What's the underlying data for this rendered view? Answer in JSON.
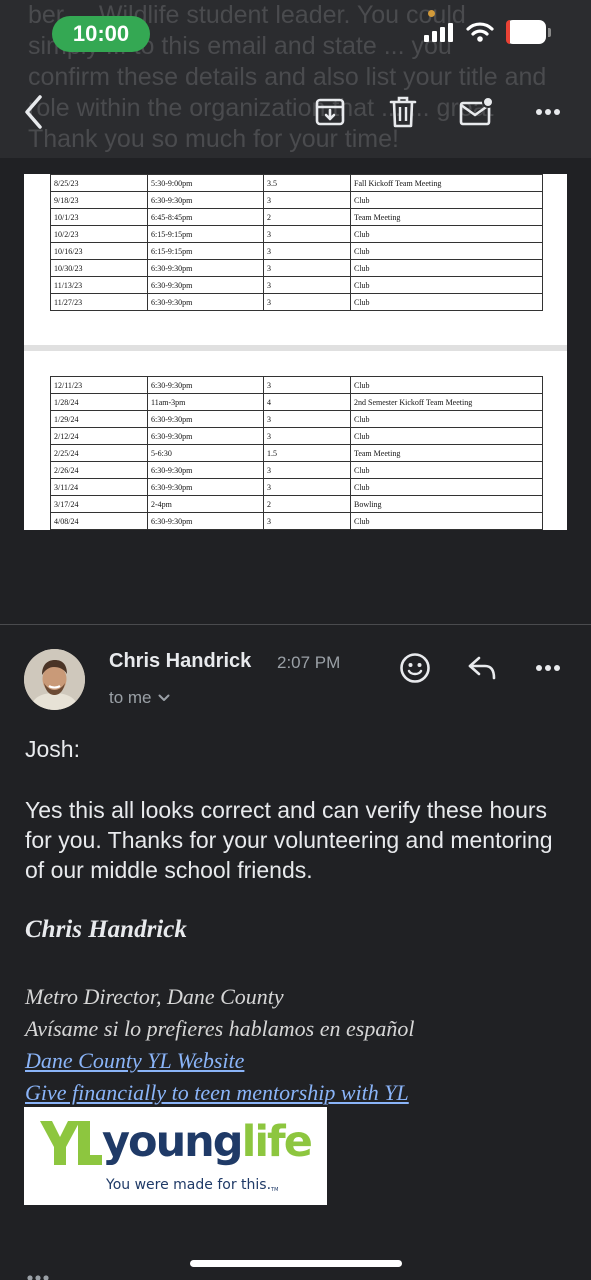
{
  "status_bar": {
    "time": "10:00",
    "battery": "10",
    "battery_level": 0.1
  },
  "background_message": {
    "text": "ber ... Wildlife student leader. You could\nsimply ... to this email and state ... you\nconfirm these details and also list your title and\nrole within the organization that ... ... great\nThank you so much for your time!"
  },
  "toolbar": {
    "back": "back",
    "archive": "archive",
    "delete": "delete",
    "mark_unread": "mark-unread",
    "more": "more"
  },
  "attachment_table": {
    "page1_rows": [
      [
        "8/25/23",
        "5:30-9:00pm",
        "3.5",
        "Fall Kickoff Team Meeting"
      ],
      [
        "9/18/23",
        "6:30-9:30pm",
        "3",
        "Club"
      ],
      [
        "10/1/23",
        "6:45-8:45pm",
        "2",
        "Team Meeting"
      ],
      [
        "10/2/23",
        "6:15-9:15pm",
        "3",
        "Club"
      ],
      [
        "10/16/23",
        "6:15-9:15pm",
        "3",
        "Club"
      ],
      [
        "10/30/23",
        "6:30-9:30pm",
        "3",
        "Club"
      ],
      [
        "11/13/23",
        "6:30-9:30pm",
        "3",
        "Club"
      ],
      [
        "11/27/23",
        "6:30-9:30pm",
        "3",
        "Club"
      ]
    ],
    "page2_rows": [
      [
        "12/11/23",
        "6:30-9:30pm",
        "3",
        "Club"
      ],
      [
        "1/28/24",
        "11am-3pm",
        "4",
        "2nd Semester Kickoff Team Meeting"
      ],
      [
        "1/29/24",
        "6:30-9:30pm",
        "3",
        "Club"
      ],
      [
        "2/12/24",
        "6:30-9:30pm",
        "3",
        "Club"
      ],
      [
        "2/25/24",
        "5-6:30",
        "1.5",
        "Team Meeting"
      ],
      [
        "2/26/24",
        "6:30-9:30pm",
        "3",
        "Club"
      ],
      [
        "3/11/24",
        "6:30-9:30pm",
        "3",
        "Club"
      ],
      [
        "3/17/24",
        "2-4pm",
        "2",
        "Bowling"
      ],
      [
        "4/08/24",
        "6:30-9:30pm",
        "3",
        "Club"
      ]
    ]
  },
  "message": {
    "sender": "Chris Handrick",
    "time": "2:07 PM",
    "recipient": "to me",
    "greeting": "Josh:",
    "body": "Yes this all looks correct and can verify these hours for you. Thanks for your volunteering and mentoring of our middle school friends."
  },
  "signature": {
    "name": "Chris Handrick",
    "title": "Metro Director, Dane County",
    "spanish_note": "Avísame si lo prefieres hablamos en español",
    "link1": "Dane County YL Website",
    "link2": "Give financially to teen mentorship with YL",
    "logo_word_1": "young",
    "logo_word_2": "life",
    "logo_tagline": "You were made for this.",
    "logo_tm": "TM"
  },
  "colors": {
    "background": "#202124",
    "time_pill": "#34a853",
    "battery": "#e94235",
    "link": "#8ab4f8",
    "logo_navy": "#1f3a67",
    "logo_green": "#8dc63f"
  }
}
